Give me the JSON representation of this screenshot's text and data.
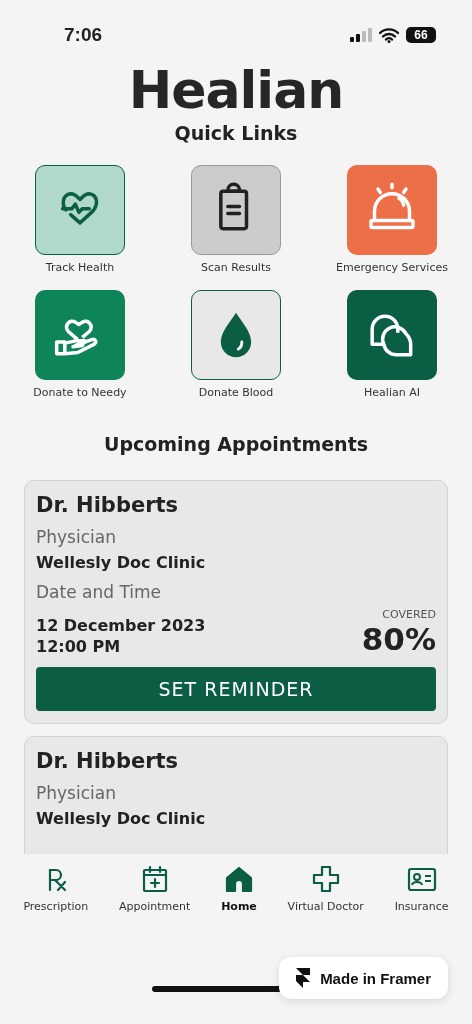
{
  "status_bar": {
    "time": "7:06",
    "battery": "66"
  },
  "app_title": "Healian",
  "quick_links": {
    "title": "Quick Links",
    "items": [
      {
        "label": "Track Health",
        "color": "#b0d8cb"
      },
      {
        "label": "Scan Results",
        "color": "#cccccc"
      },
      {
        "label": "Emergency Services",
        "color": "#ec6f48"
      },
      {
        "label": "Donate to Needy",
        "color": "#0d8559"
      },
      {
        "label": "Donate Blood",
        "color": "#e8e8e8"
      },
      {
        "label": "Healian AI",
        "color": "#0a5e44"
      }
    ]
  },
  "appointments": {
    "title": "Upcoming Appointments",
    "cards": [
      {
        "doctor": "Dr. Hibberts",
        "specialty": "Physician",
        "clinic": "Wellesly Doc Clinic",
        "date_label": "Date and Time",
        "date": "12 December 2023",
        "time": "12:00 PM",
        "covered_label": "COVERED",
        "covered": "80%",
        "button": "SET REMINDER"
      },
      {
        "doctor": "Dr. Hibberts",
        "specialty": "Physician",
        "clinic": "Wellesly Doc Clinic"
      }
    ]
  },
  "nav": [
    {
      "label": "Prescription",
      "selected": false
    },
    {
      "label": "Appointment",
      "selected": false
    },
    {
      "label": "Home",
      "selected": true
    },
    {
      "label": "Virtual Doctor",
      "selected": false
    },
    {
      "label": "Insurance",
      "selected": false
    }
  ],
  "badge": "Made in Framer"
}
